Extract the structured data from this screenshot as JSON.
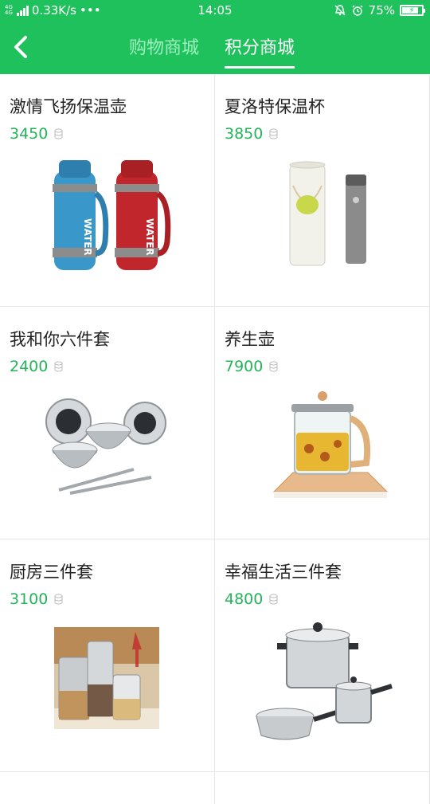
{
  "status": {
    "network": "4G 4G",
    "speed": "0.33K/s",
    "more": "•••",
    "time": "14:05",
    "battery": "75%"
  },
  "nav": {
    "tabs": [
      {
        "label": "购物商城",
        "active": false
      },
      {
        "label": "积分商城",
        "active": true
      }
    ]
  },
  "products": [
    {
      "name": "激情飞扬保温壶",
      "points": "3450"
    },
    {
      "name": "夏洛特保温杯",
      "points": "3850"
    },
    {
      "name": "我和你六件套",
      "points": "2400"
    },
    {
      "name": "养生壶",
      "points": "7900"
    },
    {
      "name": "厨房三件套",
      "points": "3100"
    },
    {
      "name": "幸福生活三件套",
      "points": "4800"
    }
  ],
  "colors": {
    "brand": "#1fc15c",
    "price": "#24b45a"
  }
}
